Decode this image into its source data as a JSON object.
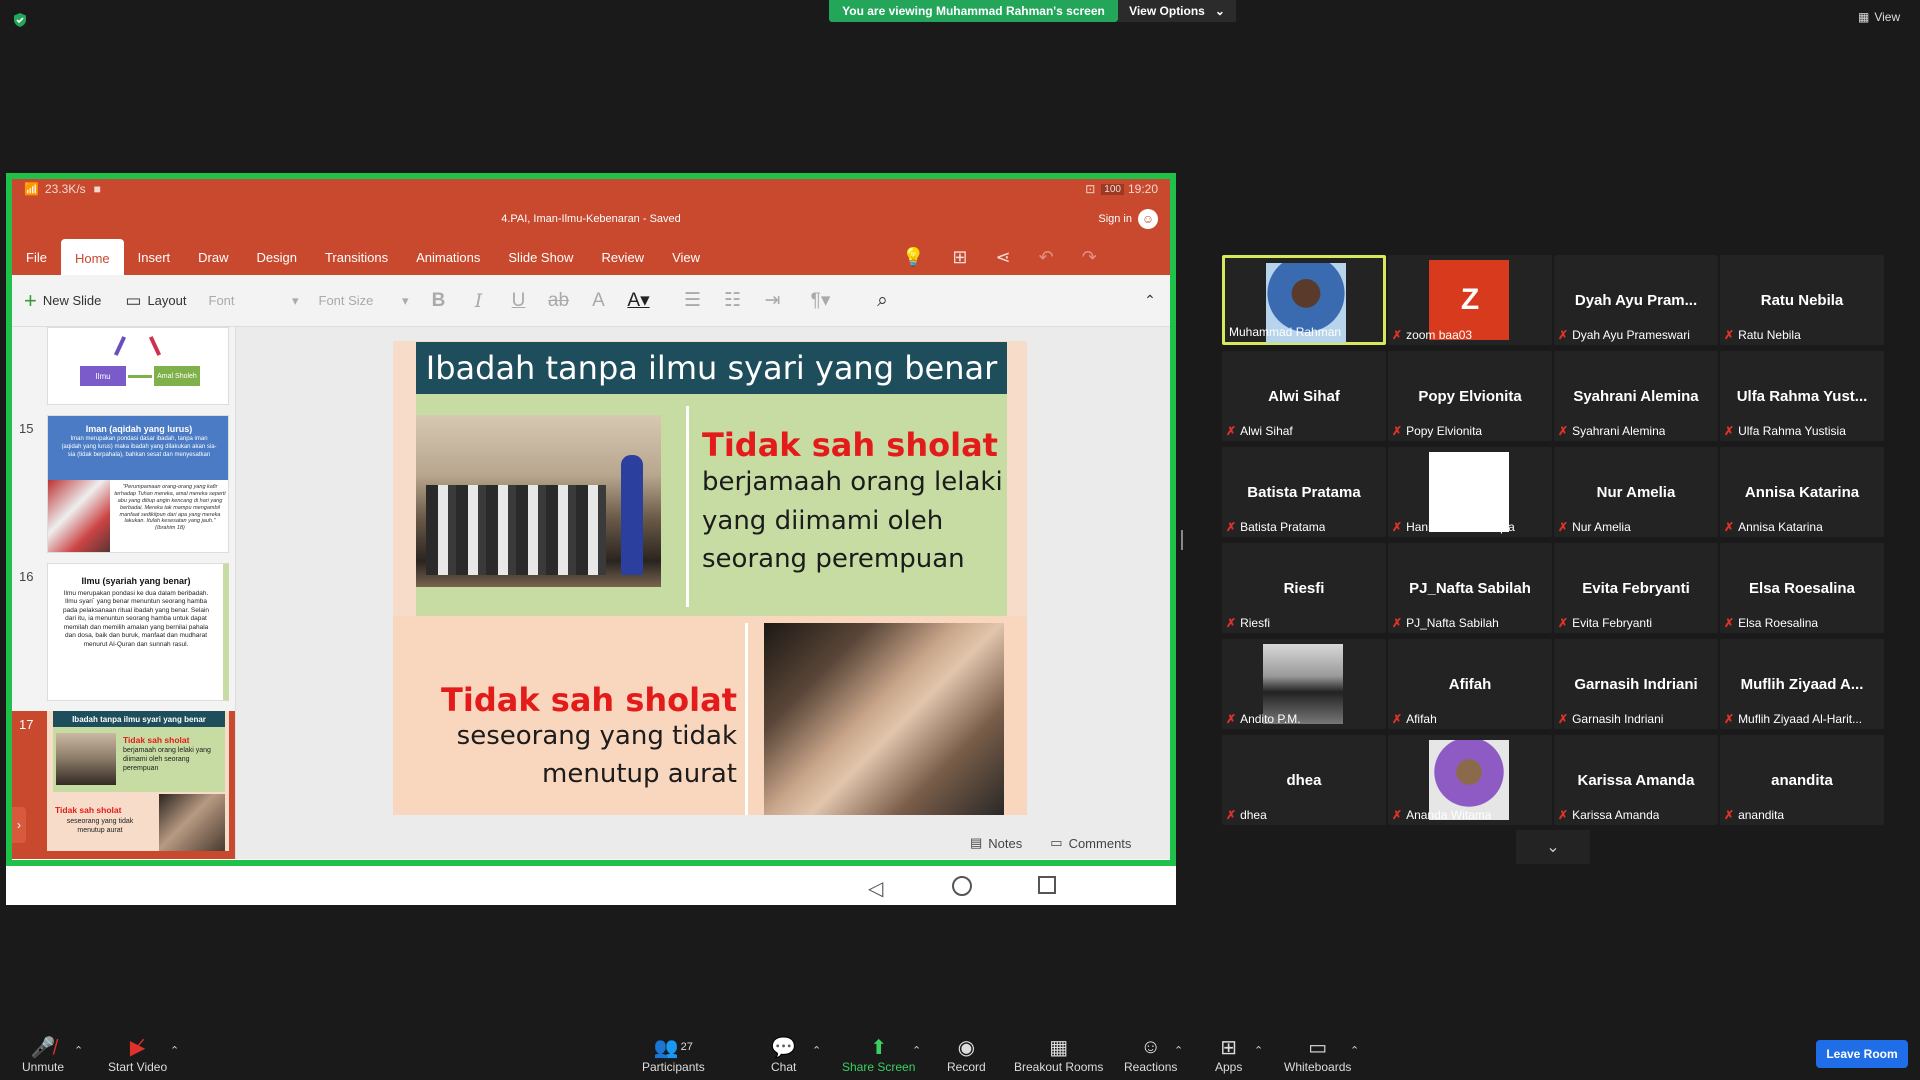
{
  "top": {
    "viewing_banner": "You are viewing Muhammad Rahman's screen",
    "view_options": "View Options",
    "view_button": "View"
  },
  "phone": {
    "speed": "23.3K/s",
    "battery": "100",
    "time": "19:20"
  },
  "ppt": {
    "title": "4.PAI, Iman-Ilmu-Kebenaran - Saved",
    "sign_in": "Sign in",
    "tabs": [
      "File",
      "Home",
      "Insert",
      "Draw",
      "Design",
      "Transitions",
      "Animations",
      "Slide Show",
      "Review",
      "View"
    ],
    "new_slide": "New Slide",
    "layout": "Layout",
    "font_placeholder": "Font",
    "font_size_placeholder": "Font Size",
    "notes": "Notes",
    "comments": "Comments"
  },
  "thumbs": {
    "t14": {
      "ilmu": "Ilmu",
      "amal": "Amal Sholeh"
    },
    "t15": {
      "num": "15",
      "title": "Iman (aqidah yang lurus)",
      "body": "Iman merupakan pondasi dasar ibadah, tanpa iman (aqidah yang lurus) maka ibadah yang dilakukan akan sia-sia (tidak berpahala), bahkan sesat dan menyesatkan",
      "quote": "\"Perumpamaan orang-orang yang kafir terhadap Tuhan mereka, amal mereka seperti abu yang ditiup angin kencang di hari yang berbadai. Mereka tak mampu mengambil manfaat sedikitpun dari apa yang mereka lakukan. Itulah kesesatan yang jauh.\" (Ibrahim 18)"
    },
    "t16": {
      "num": "16",
      "title": "Ilmu (syariah yang benar)",
      "body": "Ilmu merupakan pondasi ke dua dalam beribadah. Ilmu syari` yang benar menuntun seorang hamba pada pelaksanaan ritual ibadah yang benar. Selain dari itu, ia menuntun seorang hamba untuk dapat memilah dan memilih amalan yang bernilai pahala dan dosa, baik dan buruk, manfaat dan mudharat menurut Al-Quran dan sunnah rasul."
    },
    "t17": {
      "num": "17",
      "title": "Ibadah tanpa ilmu syari yang benar",
      "red1": "Tidak sah sholat",
      "body1": "berjamaah orang lelaki yang diimami oleh seorang perempuan",
      "red2": "Tidak sah sholat",
      "body2": "seseorang yang tidak menutup aurat"
    }
  },
  "slide": {
    "title": "Ibadah tanpa ilmu syari yang benar",
    "red1": "Tidak sah sholat",
    "body1_l1": "berjamaah orang lelaki",
    "body1_l2": "yang diimami oleh",
    "body1_l3": "seorang perempuan",
    "red2": "Tidak sah sholat",
    "body2_l1": "seseorang yang tidak",
    "body2_l2": "menutup aurat"
  },
  "participants": [
    {
      "display": "",
      "label": "Muhammad Rahman",
      "muted": false,
      "video": "person"
    },
    {
      "display": "Z",
      "label": "zoom baa03",
      "muted": true,
      "video": "avatar"
    },
    {
      "display": "Dyah Ayu Pram...",
      "label": "Dyah Ayu Prameswari",
      "muted": true
    },
    {
      "display": "Ratu Nebila",
      "label": "Ratu Nebila",
      "muted": true
    },
    {
      "display": "Alwi Sihaf",
      "label": "Alwi Sihaf",
      "muted": true
    },
    {
      "display": "Popy Elvionita",
      "label": "Popy Elvionita",
      "muted": true
    },
    {
      "display": "Syahrani Alemina",
      "label": "Syahrani Alemina",
      "muted": true
    },
    {
      "display": "Ulfa Rahma Yust...",
      "label": "Ulfa Rahma Yustisia",
      "muted": true
    },
    {
      "display": "Batista Pratama",
      "label": "Batista Pratama",
      "muted": true
    },
    {
      "display": "",
      "label": "Hanifah Amar Aaqila",
      "muted": true,
      "video": "white"
    },
    {
      "display": "Nur Amelia",
      "label": "Nur Amelia",
      "muted": true
    },
    {
      "display": "Annisa Katarina",
      "label": "Annisa Katarina",
      "muted": true
    },
    {
      "display": "Riesfi",
      "label": "Riesfi",
      "muted": true
    },
    {
      "display": "PJ_Nafta Sabilah",
      "label": "PJ_Nafta Sabilah",
      "muted": true
    },
    {
      "display": "Evita Febryanti",
      "label": "Evita Febryanti",
      "muted": true
    },
    {
      "display": "Elsa Roesalina",
      "label": "Elsa Roesalina",
      "muted": true
    },
    {
      "display": "",
      "label": "Andito P.M.",
      "muted": true,
      "video": "car"
    },
    {
      "display": "Afifah",
      "label": "Afifah",
      "muted": true
    },
    {
      "display": "Garnasih Indriani",
      "label": "Garnasih Indriani",
      "muted": true
    },
    {
      "display": "Muflih  Ziyaad A...",
      "label": "Muflih Ziyaad Al-Harit...",
      "muted": true
    },
    {
      "display": "dhea",
      "label": "dhea",
      "muted": true
    },
    {
      "display": "",
      "label": "Ananda Witama",
      "muted": true,
      "video": "person2"
    },
    {
      "display": "Karissa Amanda",
      "label": "Karissa Amanda",
      "muted": true
    },
    {
      "display": "anandita",
      "label": "anandita",
      "muted": true
    }
  ],
  "toolbar": {
    "unmute": "Unmute",
    "start_video": "Start Video",
    "participants": "Participants",
    "participants_count": "27",
    "chat": "Chat",
    "share_screen": "Share Screen",
    "record": "Record",
    "breakout": "Breakout Rooms",
    "reactions": "Reactions",
    "apps": "Apps",
    "whiteboards": "Whiteboards",
    "leave": "Leave Room"
  }
}
